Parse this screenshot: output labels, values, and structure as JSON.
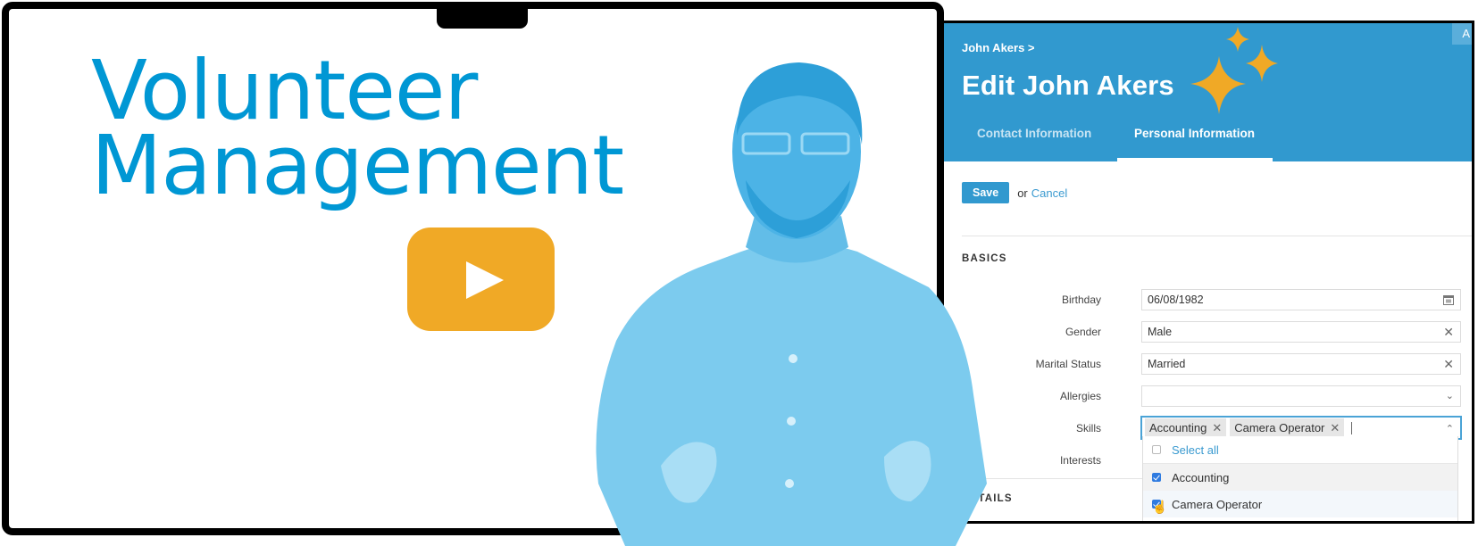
{
  "promo": {
    "headline_line1": "Volunteer",
    "headline_line2": "Management",
    "play_icon": "play-icon",
    "accent_color": "#0097d4",
    "play_color": "#f0a926"
  },
  "app": {
    "brand_color": "#3199cf",
    "corner_badge": "A",
    "breadcrumb": "John Akers >",
    "title": "Edit John Akers",
    "tabs": [
      {
        "label": "Contact Information",
        "active": false
      },
      {
        "label": "Personal Information",
        "active": true
      }
    ],
    "actions": {
      "save_label": "Save",
      "or_text": "or",
      "cancel_label": "Cancel"
    },
    "sections": {
      "basics": "BASICS",
      "details": "DETAILS"
    },
    "fields": {
      "birthday": {
        "label": "Birthday",
        "value": "06/08/1982",
        "icon": "calendar-icon"
      },
      "gender": {
        "label": "Gender",
        "value": "Male",
        "icon": "clear-icon"
      },
      "marital_status": {
        "label": "Marital Status",
        "value": "Married",
        "icon": "clear-icon"
      },
      "allergies": {
        "label": "Allergies",
        "value": "",
        "icon": "chevron-down-icon"
      },
      "skills": {
        "label": "Skills",
        "selected": [
          "Accounting",
          "Camera Operator"
        ],
        "icon": "chevron-up-icon"
      },
      "interests": {
        "label": "Interests"
      }
    },
    "skills_dropdown": {
      "select_all": "Select all",
      "options": [
        {
          "label": "Accounting",
          "checked": true
        },
        {
          "label": "Camera Operator",
          "checked": true
        }
      ]
    }
  }
}
